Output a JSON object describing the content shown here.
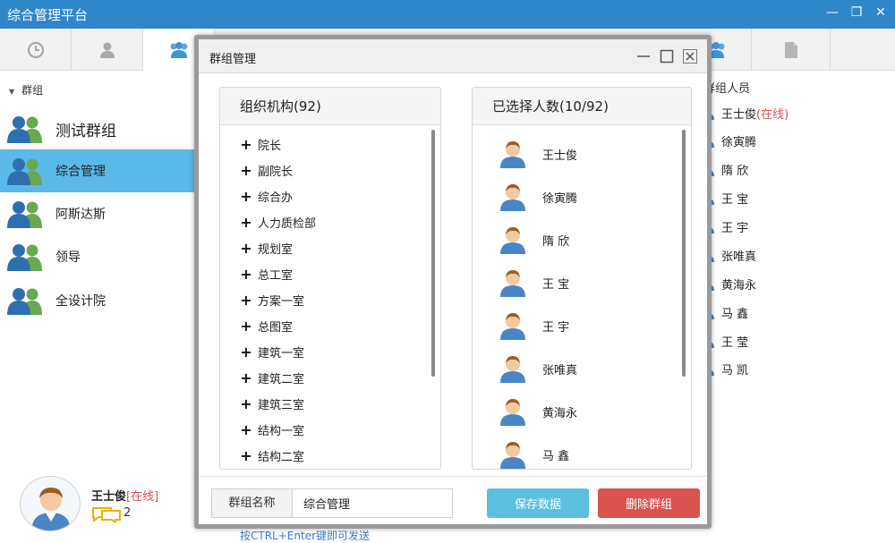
{
  "app": {
    "title": "综合管理平台",
    "window_controls": {
      "minimize": "—",
      "restore": "❐",
      "close": "✕"
    }
  },
  "tabs": [
    {
      "icon": "clock-icon"
    },
    {
      "icon": "person-icon"
    },
    {
      "icon": "group-icon",
      "active": true
    },
    {
      "icon": "group-icon"
    },
    {
      "icon": "document-icon"
    }
  ],
  "sidebar": {
    "header": "群组",
    "groups": [
      {
        "label": "测试群组"
      },
      {
        "label": "综合管理",
        "selected": true
      },
      {
        "label": "阿斯达斯"
      },
      {
        "label": "领导"
      },
      {
        "label": "全设计院"
      }
    ]
  },
  "current_user": {
    "name": "王士俊",
    "status": "[在线]",
    "message_count": "2"
  },
  "hint": "按CTRL+Enter键即可发送",
  "members": {
    "title": "群组人员",
    "list": [
      {
        "name": "王士俊",
        "status": "(在线)"
      },
      {
        "name": "徐寅腾",
        "status": ""
      },
      {
        "name": "隋 欣",
        "status": ""
      },
      {
        "name": "王 宝",
        "status": ""
      },
      {
        "name": "王 宇",
        "status": ""
      },
      {
        "name": "张唯真",
        "status": ""
      },
      {
        "name": "黄海永",
        "status": ""
      },
      {
        "name": "马 鑫",
        "status": ""
      },
      {
        "name": "王 莹",
        "status": ""
      },
      {
        "name": "马 凯",
        "status": ""
      }
    ]
  },
  "dialog": {
    "title": "群组管理",
    "org_panel": {
      "title": "组织机构(92)",
      "items": [
        "院长",
        "副院长",
        "综合办",
        "人力质检部",
        "规划室",
        "总工室",
        "方案一室",
        "总图室",
        "建筑一室",
        "建筑二室",
        "建筑三室",
        "结构一室",
        "结构二室"
      ]
    },
    "selected_panel": {
      "title": "已选择人数(10/92)",
      "items": [
        "王士俊",
        "徐寅腾",
        "隋 欣",
        "王 宝",
        "王 宇",
        "张唯真",
        "黄海永",
        "马 鑫"
      ]
    },
    "group_name_label": "群组名称",
    "group_name_value": "综合管理",
    "save_label": "保存数据",
    "delete_label": "删除群组"
  },
  "colors": {
    "titlebar": "#2f86c9",
    "selected_row": "#5bb9ea",
    "save_button": "#5bc0de",
    "delete_button": "#d9534f",
    "online_status": "#d9534f"
  }
}
